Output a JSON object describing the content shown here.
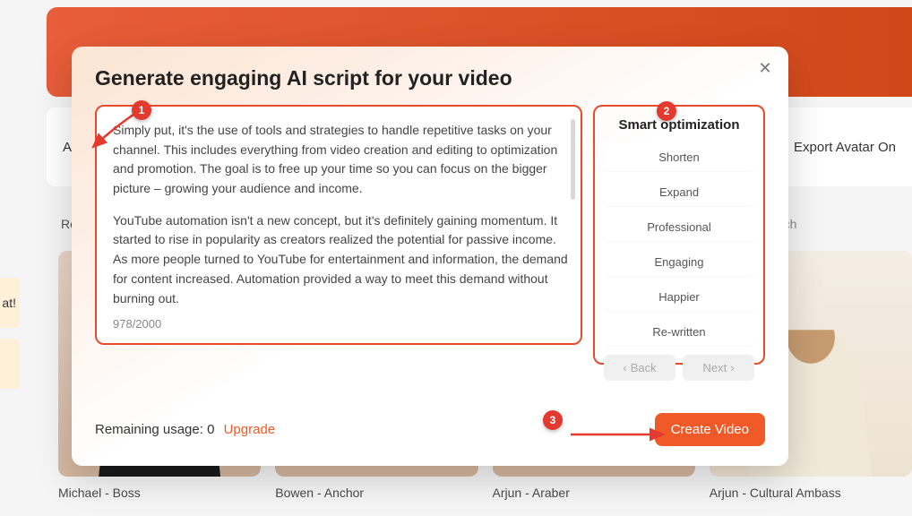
{
  "background": {
    "tabs": [
      "All",
      "Export Avatar On"
    ],
    "labelRe": "Re",
    "labelRch": "rch",
    "chip1": "at!",
    "avatars": [
      {
        "name": "Michael - Boss"
      },
      {
        "name": "Bowen - Anchor"
      },
      {
        "name": "Arjun - Araber"
      },
      {
        "name": "Arjun - Cultural Ambass"
      }
    ]
  },
  "modal": {
    "title": "Generate engaging AI script for your video",
    "script": {
      "p1": "Simply put, it's the use of tools and strategies to handle repetitive tasks on your channel. This includes everything from video creation and editing to optimization and promotion. The goal is to free up your time so you can focus on the bigger picture – growing your audience and income.",
      "p2": "YouTube automation isn't a new concept, but it's definitely gaining momentum. It started to rise in popularity as creators realized the potential for passive income. As more people turned to YouTube for entertainment and information, the demand for content increased. Automation provided a way to meet this demand without burning out.",
      "charCount": "978/2000"
    },
    "optimization": {
      "title": "Smart optimization",
      "buttons": [
        "Shorten",
        "Expand",
        "Professional",
        "Engaging",
        "Happier",
        "Re-written"
      ],
      "back": "Back",
      "next": "Next"
    },
    "footer": {
      "usageLabel": "Remaining usage: 0",
      "upgrade": "Upgrade",
      "create": "Create Video"
    }
  },
  "callouts": {
    "c1": "1",
    "c2": "2",
    "c3": "3"
  }
}
